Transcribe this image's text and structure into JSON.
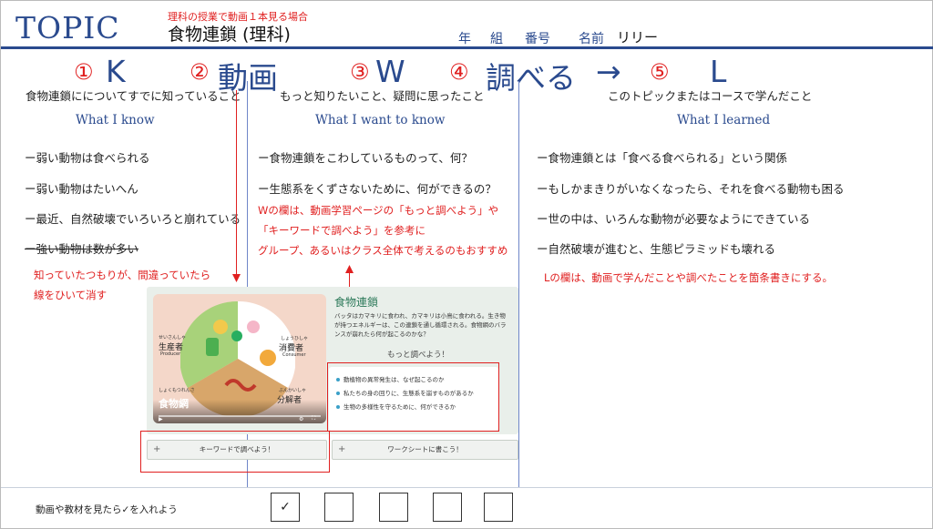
{
  "header": {
    "topic_label": "TOPIC",
    "note": "理科の授業で動画１本見る場合",
    "subject": "食物連鎖 (理科)",
    "field_year": "年",
    "field_class": "組",
    "field_number": "番号",
    "field_name_label": "名前",
    "field_name_value": "リリー"
  },
  "kwl": {
    "c1": "①",
    "k": "K",
    "c2": "②",
    "video": "動画",
    "c3": "③",
    "w": "W",
    "c4": "④",
    "research": "調べる",
    "arrow": "→",
    "c5": "⑤",
    "l": "L"
  },
  "columns": {
    "k": {
      "heading": "食物連鎖にについてすでに知っていること",
      "sub": "What I know",
      "items": [
        "ー弱い動物は食べられる",
        "ー弱い動物はたいへん",
        "ー最近、自然破壊でいろいろと崩れている",
        "ー強い動物は数が多い"
      ],
      "note1": "知っていたつもりが、間違っていたら",
      "note2": "線をひいて消す"
    },
    "w": {
      "heading": "もっと知りたいこと、疑問に思ったこと",
      "sub": "What I want to know",
      "items": [
        "ー食物連鎖をこわしているものって、何？",
        "ー生態系をくずさないために、何ができるの？"
      ],
      "note1": "Wの欄は、動画学習ページの「もっと調べよう」や",
      "note2": "「キーワードで調べよう」を参考に",
      "note3": "グループ、あるいはクラス全体で考えるのもおすすめ"
    },
    "l": {
      "heading": "このトピックまたはコースで学んだこと",
      "sub": "What I learned",
      "items": [
        "ー食物連鎖とは「食べる食べられる」という関係",
        "ーもしかまきりがいなくなったら、それを食べる動物も困る",
        "ー世の中は、いろんな動物が必要なようにできている",
        "ー自然破壊が進むと、生態ピラミッドも壊れる"
      ],
      "note": "Lの欄は、動画で学んだことや調べたことを箇条書きにする。"
    }
  },
  "embed": {
    "video": {
      "producer_ruby": "せいさんしゃ",
      "producer": "生産者",
      "producer_en": "Producer",
      "consumer_ruby": "しょうひしゃ",
      "consumer": "消費者",
      "consumer_en": "Consumer",
      "decomposer_ruby": "ぶんかいしゃ",
      "decomposer": "分解者",
      "chain_ruby": "しょくもつれんさ",
      "title": "食物網"
    },
    "title": "食物連鎖",
    "body": "バッタはカマキリに食われ、カマキリは小鳥に食われる。生き物が持つエネルギーは、この連鎖を通し循環される。食物網のバランスが崩れたら何が起こるのかな？",
    "more": "もっと調べよう！",
    "list": [
      "動植物の異常発生は、なぜ起こるのか",
      "私たちの身の回りに、生態系を崩すものがあるか",
      "生物の多様性を守るために、何ができるか"
    ],
    "button_keyword": "キーワードで調べよう！",
    "button_worksheet": "ワークシートに書こう！",
    "plus": "+"
  },
  "footer": {
    "label": "動画や教材を見たら✓を入れよう",
    "checks": [
      "✓",
      "",
      "",
      "",
      ""
    ]
  },
  "colors": {
    "accent_blue": "#2a4a8e",
    "note_red": "#e02020",
    "embed_green": "#2d7a5a"
  }
}
